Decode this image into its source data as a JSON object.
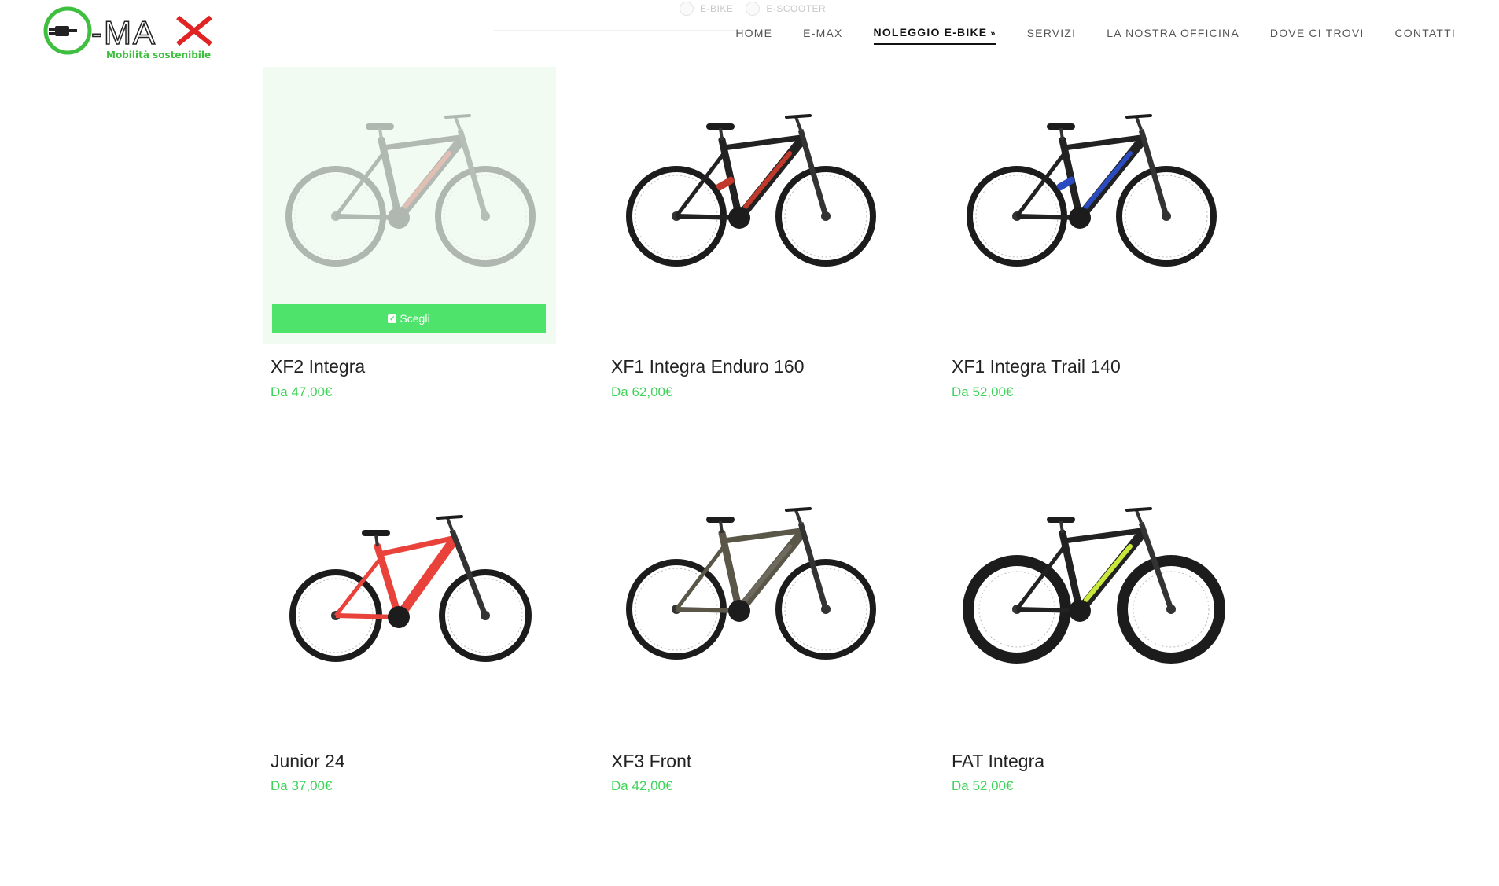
{
  "brand": {
    "logo_text": "E-MAX",
    "tagline": "Mobilità sostenibile",
    "colors": {
      "green": "#3fbf3f",
      "red": "#e02424",
      "dark": "#222222"
    }
  },
  "filters": [
    {
      "label": "E-BIKE"
    },
    {
      "label": "E-SCOOTER"
    }
  ],
  "nav": {
    "items": [
      {
        "label": "HOME"
      },
      {
        "label": "E-MAX"
      },
      {
        "label": "NOLEGGIO E-BIKE",
        "active": true
      },
      {
        "label": "SERVIZI"
      },
      {
        "label": "LA NOSTRA OFFICINA"
      },
      {
        "label": "DOVE CI TROVI"
      },
      {
        "label": "CONTATTI"
      }
    ],
    "dropdown_icon": "chevron-double-down-icon"
  },
  "products": [
    {
      "name": "XF2 Integra",
      "price": "Da 47,00€",
      "button": "Scegli",
      "hovered": true,
      "frame": "hardtail",
      "accent": "#c0392b"
    },
    {
      "name": "XF1 Integra Enduro 160",
      "price": "Da 62,00€",
      "frame": "full",
      "accent": "#c0392b"
    },
    {
      "name": "XF1 Integra Trail 140",
      "price": "Da 52,00€",
      "frame": "full",
      "accent": "#2b4bc0"
    },
    {
      "name": "Junior 24",
      "price": "Da 37,00€",
      "frame": "junior",
      "accent": "#e8423b"
    },
    {
      "name": "XF3 Front",
      "price": "Da 42,00€",
      "frame": "hardtail",
      "accent": "#6e6a5e"
    },
    {
      "name": "FAT Integra",
      "price": "Da 52,00€",
      "frame": "fat",
      "accent": "#c8e83a"
    }
  ],
  "accent": "#4ee36b",
  "price_color": "#3fd35a"
}
